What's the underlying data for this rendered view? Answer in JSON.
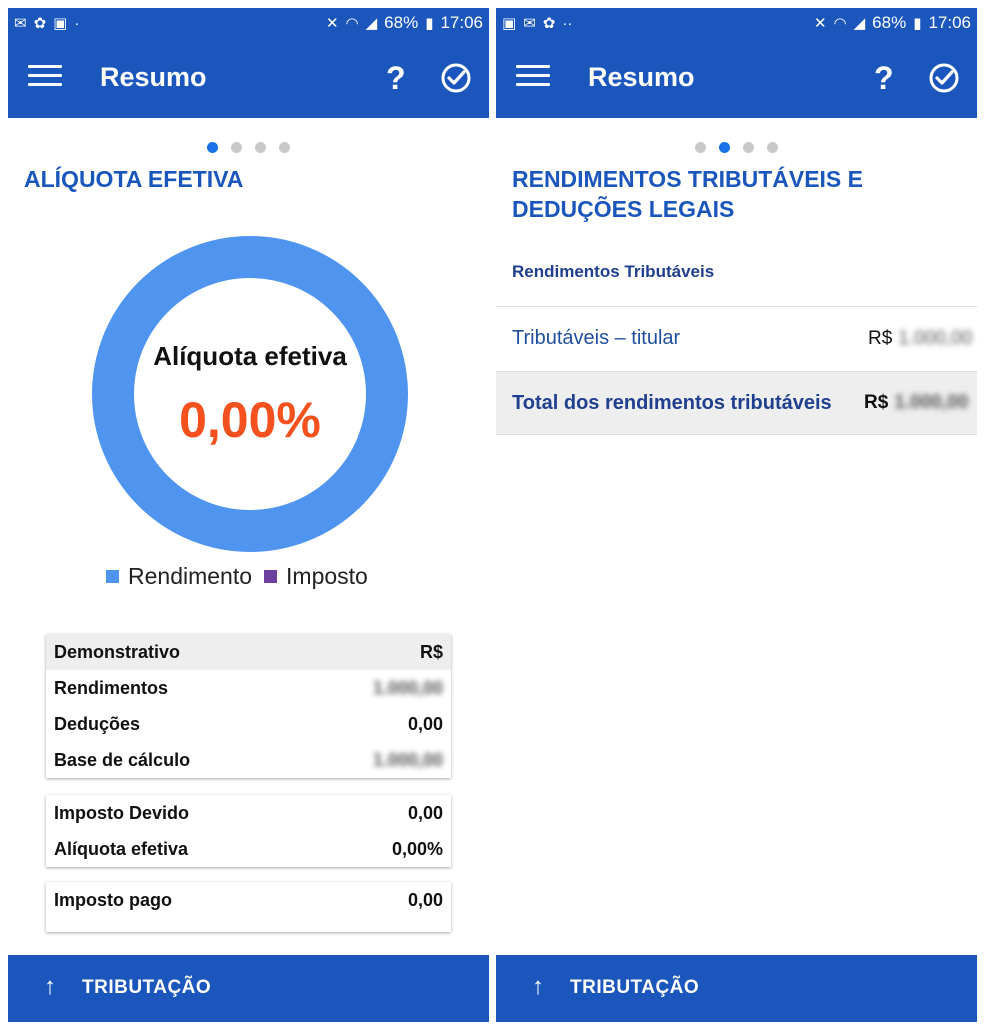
{
  "status_bar": {
    "battery": "68%",
    "time": "17:06"
  },
  "app": {
    "title": "Resumo",
    "help_symbol": "?"
  },
  "screen1": {
    "section_title": "ALÍQUOTA EFETIVA",
    "donut": {
      "label": "Alíquota efetiva",
      "value": "0,00%",
      "ring_color": "#4f95f0"
    },
    "legend": [
      {
        "label": "Rendimento",
        "color": "#4f95f0"
      },
      {
        "label": "Imposto",
        "color": "#6a3f9e"
      }
    ],
    "card1": {
      "header": {
        "label": "Demonstrativo",
        "value": "R$"
      },
      "rows": [
        {
          "label": "Rendimentos",
          "value": "1.000,00"
        },
        {
          "label": "Deduções",
          "value": "0,00"
        },
        {
          "label": "Base de cálculo",
          "value": "1.000,00"
        }
      ]
    },
    "card2": {
      "rows": [
        {
          "label": "Imposto Devido",
          "value": "0,00"
        },
        {
          "label": "Alíquota efetiva",
          "value": "0,00%"
        }
      ]
    },
    "card3": {
      "rows": [
        {
          "label": "Imposto pago",
          "value": "0,00"
        }
      ]
    }
  },
  "screen2": {
    "section_title_line1": "RENDIMENTOS TRIBUTÁVEIS E",
    "section_title_line2": "DEDUÇÕES LEGAIS",
    "subhead": "Rendimentos Tributáveis",
    "rows": [
      {
        "label": "Tributáveis – titular",
        "currency": "R$",
        "value": "1.000,00"
      },
      {
        "label": "Total dos rendimentos tributáveis",
        "currency": "R$",
        "value": "1.000,00"
      }
    ]
  },
  "bottom_bar": {
    "label": "TRIBUTAÇÃO"
  },
  "colors": {
    "primary": "#1a56bc",
    "accent": "#f4511e",
    "dot_active": "#1a73e8"
  }
}
